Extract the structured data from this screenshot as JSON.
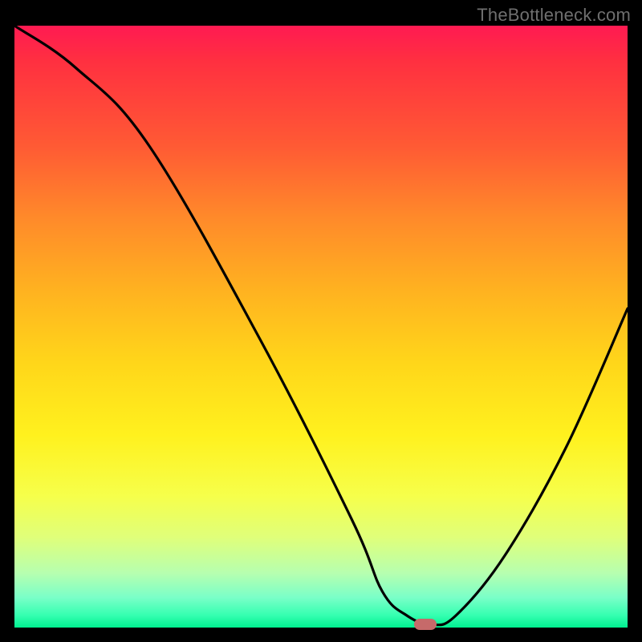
{
  "watermark": "TheBottleneck.com",
  "chart_data": {
    "type": "line",
    "title": "",
    "xlabel": "",
    "ylabel": "",
    "xlim": [
      0,
      100
    ],
    "ylim": [
      0,
      100
    ],
    "grid": false,
    "series": [
      {
        "name": "bottleneck-curve",
        "x": [
          0,
          10,
          22,
          40,
          55,
          60,
          64,
          68,
          72,
          80,
          90,
          100
        ],
        "y": [
          100,
          93,
          80,
          48,
          18,
          6,
          2,
          0.5,
          2,
          12,
          30,
          53
        ]
      }
    ],
    "marker": {
      "x": 67,
      "y": 0.5,
      "color": "#c66a6a"
    },
    "background_gradient": {
      "top": "#ff1a52",
      "mid": "#ffd61a",
      "bottom": "#00f090"
    }
  },
  "colors": {
    "page_bg": "#000000",
    "watermark": "#6f6f6f",
    "curve": "#000000",
    "marker": "#c66a6a"
  }
}
